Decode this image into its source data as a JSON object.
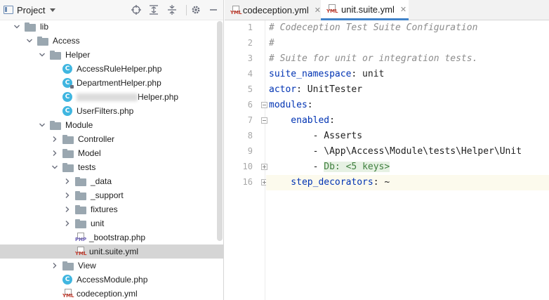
{
  "project_panel": {
    "title": "Project",
    "toolbar_icons": [
      "locate-icon",
      "expand-all-icon",
      "collapse-all-icon",
      "gear-icon",
      "hide-icon"
    ]
  },
  "tree": [
    {
      "label": "lib",
      "type": "folder",
      "expanded": true
    },
    {
      "label": "Access",
      "type": "folder",
      "expanded": true
    },
    {
      "label": "Helper",
      "type": "folder",
      "expanded": true
    },
    {
      "label": "AccessRuleHelper.php",
      "type": "class"
    },
    {
      "label": "DepartmentHelper.php",
      "type": "class-locked"
    },
    {
      "label": "Helper.php",
      "type": "class",
      "obscured_prefix": true
    },
    {
      "label": "UserFilters.php",
      "type": "class"
    },
    {
      "label": "Module",
      "type": "folder",
      "expanded": true
    },
    {
      "label": "Controller",
      "type": "folder",
      "expanded": false
    },
    {
      "label": "Model",
      "type": "folder",
      "expanded": false
    },
    {
      "label": "tests",
      "type": "folder",
      "expanded": true
    },
    {
      "label": "_data",
      "type": "folder",
      "expanded": false
    },
    {
      "label": "_support",
      "type": "folder",
      "expanded": false
    },
    {
      "label": "fixtures",
      "type": "folder",
      "expanded": false
    },
    {
      "label": "unit",
      "type": "folder",
      "expanded": false
    },
    {
      "label": "_bootstrap.php",
      "type": "php"
    },
    {
      "label": "unit.suite.yml",
      "type": "yml",
      "selected": true
    },
    {
      "label": "View",
      "type": "folder",
      "expanded": false
    },
    {
      "label": "AccessModule.php",
      "type": "class"
    },
    {
      "label": "codeception.yml",
      "type": "yml"
    }
  ],
  "tabs": [
    {
      "label": "codeception.yml",
      "active": false,
      "icon_tag": "YML"
    },
    {
      "label": "unit.suite.yml",
      "active": true,
      "icon_tag": "YML"
    }
  ],
  "file_icon_tags": {
    "yml": "YML",
    "php": "PHP"
  },
  "editor": {
    "lines": [
      {
        "num": "1",
        "parts": [
          {
            "t": "# Codeception Test Suite Configuration",
            "c": "c-comment"
          }
        ]
      },
      {
        "num": "2",
        "parts": [
          {
            "t": "#",
            "c": "c-comment"
          }
        ]
      },
      {
        "num": "3",
        "parts": [
          {
            "t": "# Suite for unit or integration tests.",
            "c": "c-comment"
          }
        ]
      },
      {
        "num": "4",
        "parts": [
          {
            "t": "suite_namespace",
            "c": "c-key"
          },
          {
            "t": ": unit",
            "c": "c-val"
          }
        ]
      },
      {
        "num": "5",
        "parts": [
          {
            "t": "actor",
            "c": "c-key"
          },
          {
            "t": ": UnitTester",
            "c": "c-val"
          }
        ]
      },
      {
        "num": "6",
        "parts": [
          {
            "t": "modules",
            "c": "c-key"
          },
          {
            "t": ":",
            "c": "c-val"
          }
        ],
        "fold": "open"
      },
      {
        "num": "7",
        "parts": [
          {
            "t": "    enabled",
            "c": "c-key"
          },
          {
            "t": ":",
            "c": "c-val"
          }
        ],
        "fold": "open"
      },
      {
        "num": "8",
        "parts": [
          {
            "t": "        - Asserts",
            "c": "c-val"
          }
        ]
      },
      {
        "num": "9",
        "parts": [
          {
            "t": "        - \\App\\Access\\Module\\tests\\Helper\\Unit",
            "c": "c-val"
          }
        ]
      },
      {
        "num": "10",
        "parts": [
          {
            "t": "        - ",
            "c": "c-val"
          },
          {
            "t": "Db: <5 keys>",
            "c": "c-folded"
          }
        ],
        "fold": "closed"
      },
      {
        "num": "16",
        "parts": [
          {
            "t": "    step_decorators",
            "c": "c-key"
          },
          {
            "t": ": ~",
            "c": "c-val"
          }
        ],
        "fold": "closed",
        "current": true
      }
    ]
  },
  "colors": {
    "accent": "#4083c9",
    "selection": "#d5d5d5",
    "key": "#0033b3",
    "comment": "#8c8c8c"
  }
}
